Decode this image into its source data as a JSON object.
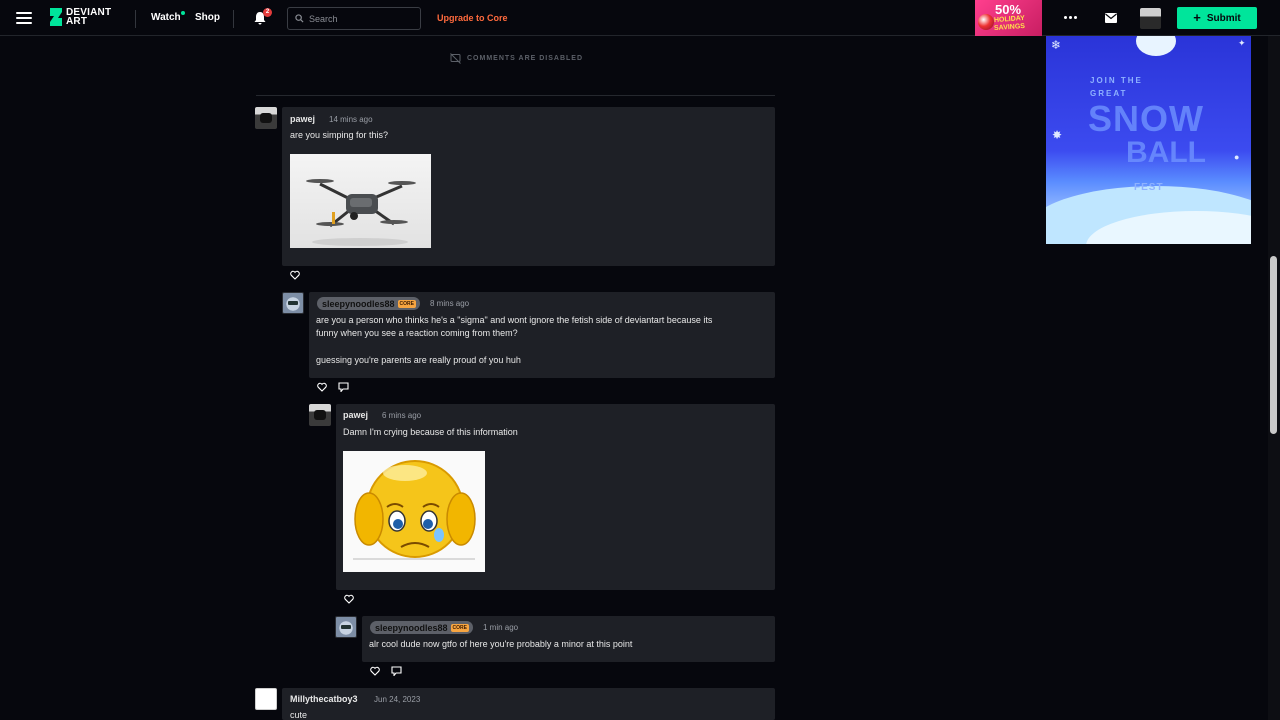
{
  "nav": {
    "logo_line1": "DEVIANT",
    "logo_line2": "ART",
    "watch": "Watch",
    "shop": "Shop",
    "notif_count": "2",
    "search_placeholder": "Search",
    "upgrade": "Upgrade to Core",
    "promo_pct": "50%",
    "promo_line1": "HOLIDAY",
    "promo_line2": "SAVINGS",
    "submit": "Submit"
  },
  "ad": {
    "line1": "JOIN THE",
    "line2": "GREAT",
    "line3": "SNOW",
    "line4": "BALL",
    "line5": "FEST"
  },
  "comments_disabled": "COMMENTS ARE DISABLED",
  "comments": [
    {
      "user": "pawej",
      "time": "14 mins ago",
      "text": "are you simping for this?"
    },
    {
      "user": "sleepynoodles88",
      "badge": "CORE",
      "time": "8 mins ago",
      "text1": "are you a person who thinks he's a \"sigma\" and wont ignore the fetish side of deviantart because its",
      "text2": "funny when you see a reaction coming from them?",
      "text3": "guessing you're parents are really proud of you huh"
    },
    {
      "user": "pawej",
      "time": "6 mins ago",
      "text": "Damn I'm crying because of this information"
    },
    {
      "user": "sleepynoodles88",
      "badge": "CORE",
      "time": "1 min ago",
      "text": "alr cool dude now gtfo of here you're probably a minor at this point"
    },
    {
      "user": "Millythecatboy3",
      "time": "Jun 24, 2023",
      "text": "cute"
    }
  ],
  "colors": {
    "accent_green": "#00e59b",
    "upgrade_orange": "#ff6a3d",
    "comment_bg": "#1e2026",
    "core_badge": "#f7a541"
  }
}
